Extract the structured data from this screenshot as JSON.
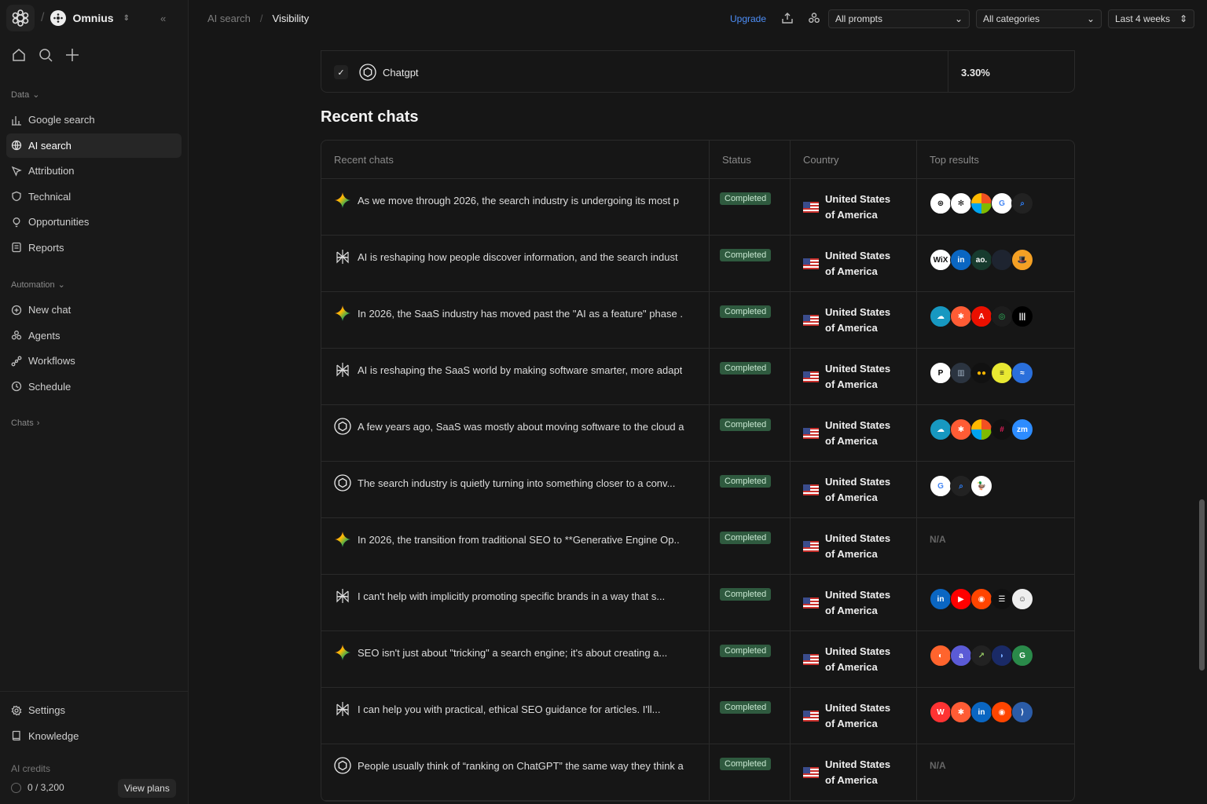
{
  "workspace": {
    "name": "Omnius"
  },
  "sidebar": {
    "data_label": "Data",
    "data_items": [
      {
        "label": "Google search",
        "icon": "bar-chart-icon"
      },
      {
        "label": "AI search",
        "icon": "globe-icon",
        "active": true
      },
      {
        "label": "Attribution",
        "icon": "cursor-icon"
      },
      {
        "label": "Technical",
        "icon": "shield-icon"
      },
      {
        "label": "Opportunities",
        "icon": "lightbulb-icon"
      },
      {
        "label": "Reports",
        "icon": "report-icon"
      }
    ],
    "automation_label": "Automation",
    "automation_items": [
      {
        "label": "New chat",
        "icon": "chat-plus-icon"
      },
      {
        "label": "Agents",
        "icon": "agents-icon"
      },
      {
        "label": "Workflows",
        "icon": "workflow-icon"
      },
      {
        "label": "Schedule",
        "icon": "clock-icon"
      }
    ],
    "chats_label": "Chats",
    "footer_items": [
      {
        "label": "Settings",
        "icon": "gear-icon"
      },
      {
        "label": "Knowledge",
        "icon": "book-icon"
      }
    ],
    "credits_label": "AI credits",
    "credits_value": "0 / 3,200",
    "view_plans": "View plans"
  },
  "topbar": {
    "breadcrumb_parent": "AI search",
    "breadcrumb_current": "Visibility",
    "upgrade": "Upgrade",
    "prompts_filter": "All prompts",
    "categories_filter": "All categories",
    "date_filter": "Last 4 weeks"
  },
  "top_row": {
    "name": "Chatgpt",
    "value": "3.30%"
  },
  "section_title": "Recent chats",
  "table": {
    "headers": [
      "Recent chats",
      "Status",
      "Country",
      "Top results"
    ],
    "rows": [
      {
        "ai": "gemini",
        "text": "As we move through 2026, the search industry is undergoing its most p",
        "status": "Completed",
        "country": [
          "United States",
          "of America"
        ],
        "results": [
          "chatgpt",
          "perplexity",
          "microsoft",
          "google",
          "search"
        ]
      },
      {
        "ai": "perplexity",
        "text": "AI is reshaping how people discover information, and the search indust",
        "status": "Completed",
        "country": [
          "United States",
          "of America"
        ],
        "results": [
          "wix",
          "linkedin",
          "ao",
          "dark",
          "hat"
        ]
      },
      {
        "ai": "gemini",
        "text": "In 2026, the SaaS industry has moved past the \"AI as a feature\" phase .",
        "status": "Completed",
        "country": [
          "United States",
          "of America"
        ],
        "results": [
          "salesforce",
          "hubspot",
          "adobe",
          "circle",
          "wave"
        ]
      },
      {
        "ai": "perplexity",
        "text": "AI is reshaping the SaaS world by making software smarter, more adapt",
        "status": "Completed",
        "country": [
          "United States",
          "of America"
        ],
        "results": [
          "p",
          "bars",
          "dots",
          "yellow",
          "blue-wave"
        ]
      },
      {
        "ai": "chatgpt",
        "text": "A few years ago, SaaS was mostly about moving software to the cloud a",
        "status": "Completed",
        "country": [
          "United States",
          "of America"
        ],
        "results": [
          "salesforce",
          "hubspot",
          "microsoft",
          "slack",
          "zoom"
        ]
      },
      {
        "ai": "chatgpt",
        "text": "The search industry is quietly turning into something closer to a conv...",
        "status": "Completed",
        "country": [
          "United States",
          "of America"
        ],
        "results": [
          "google",
          "search",
          "duck"
        ]
      },
      {
        "ai": "gemini",
        "text": "In 2026, the transition from traditional SEO to **Generative Engine Op..",
        "status": "Completed",
        "country": [
          "United States",
          "of America"
        ],
        "results": [],
        "na": "N/A"
      },
      {
        "ai": "perplexity",
        "text": "I can't help with implicitly promoting specific brands in a way that s...",
        "status": "Completed",
        "country": [
          "United States",
          "of America"
        ],
        "results": [
          "linkedin",
          "youtube",
          "reddit",
          "stripes",
          "face"
        ]
      },
      {
        "ai": "gemini",
        "text": "SEO isn't just about \"tricking\" a search engine; it's about creating a...",
        "status": "Completed",
        "country": [
          "United States",
          "of America"
        ],
        "results": [
          "semrush",
          "a",
          "graph",
          "dark-blue",
          "g-green"
        ]
      },
      {
        "ai": "perplexity",
        "text": "I can help you with practical, ethical SEO guidance for articles. I'll...",
        "status": "Completed",
        "country": [
          "United States",
          "of America"
        ],
        "results": [
          "wordpress",
          "hubspot",
          "linkedin",
          "reddit",
          "arrow"
        ]
      },
      {
        "ai": "chatgpt",
        "text": "People usually think of “ranking on ChatGPT” the same way they think a",
        "status": "Completed",
        "country": [
          "United States",
          "of America"
        ],
        "results": [],
        "na": "N/A"
      }
    ]
  }
}
